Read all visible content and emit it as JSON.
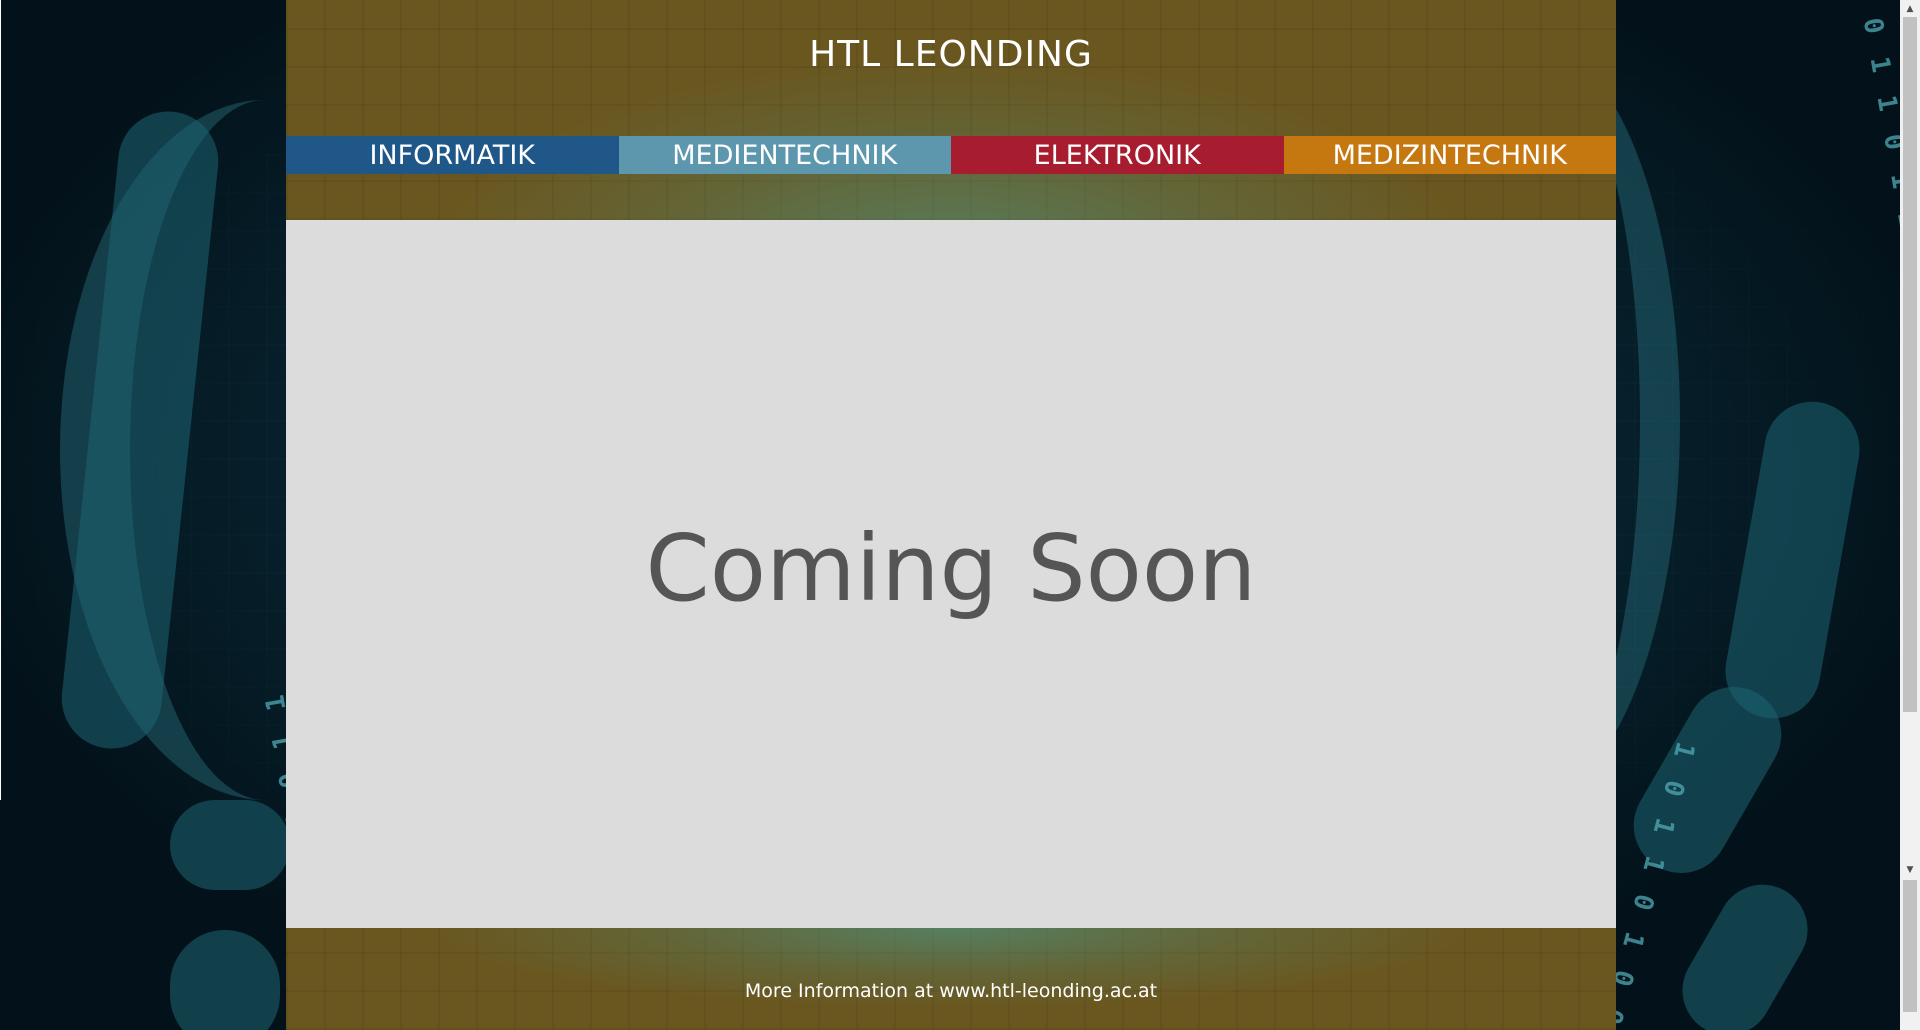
{
  "header": {
    "title": "HTL LEONDING"
  },
  "nav": {
    "items": [
      {
        "label": "INFORMATIK",
        "color": "#1f5788"
      },
      {
        "label": "MEDIENTECHNIK",
        "color": "#5d97ad"
      },
      {
        "label": "ELEKTRONIK",
        "color": "#a71c2f"
      },
      {
        "label": "MEDIZINTECHNIK",
        "color": "#c67810"
      }
    ]
  },
  "main": {
    "heading": "Coming Soon"
  },
  "footer": {
    "prefix": "More Information at ",
    "link": "www.htl-leonding.ac.at"
  },
  "colors": {
    "header_bg": "#6a5720",
    "content_bg": "#dcdcdc",
    "page_bg": "#041820"
  },
  "icons": {
    "scroll_up": "scroll-up-arrow-icon",
    "scroll_down": "scroll-down-arrow-icon"
  }
}
